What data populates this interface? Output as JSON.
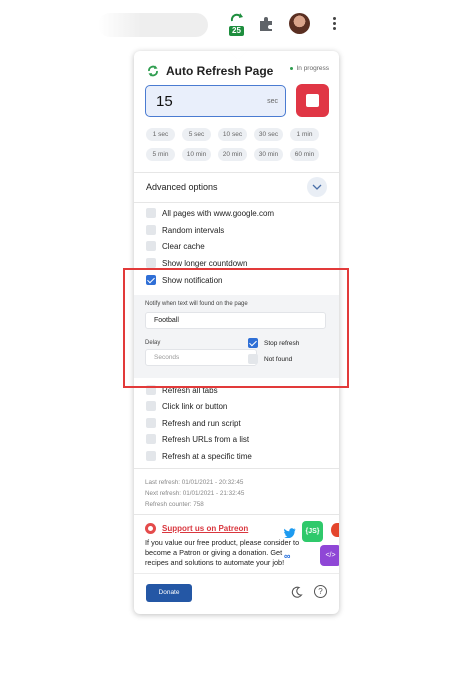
{
  "toolbar": {
    "extension_badge": "25",
    "icons": [
      "refresh-extension-icon",
      "puzzle-icon",
      "avatar",
      "kebab-menu-icon"
    ]
  },
  "popup": {
    "title": "Auto Refresh Page",
    "status": "In progress",
    "timer": {
      "value": "15",
      "unit": "sec"
    },
    "presets": [
      "1 sec",
      "5 sec",
      "10 sec",
      "30 sec",
      "1 min",
      "5 min",
      "10 min",
      "20 min",
      "30 min",
      "60 min"
    ],
    "advanced_title": "Advanced options",
    "options": [
      {
        "label": "All pages with www.google.com",
        "checked": false
      },
      {
        "label": "Random intervals",
        "checked": false
      },
      {
        "label": "Clear cache",
        "checked": false
      },
      {
        "label": "Show longer countdown",
        "checked": false
      },
      {
        "label": "Show notification",
        "checked": true
      }
    ],
    "notification": {
      "label": "Notify when text will found on the page",
      "value": "Football",
      "delay_label": "Delay",
      "delay_placeholder": "Seconds",
      "stop_refresh": {
        "label": "Stop refresh",
        "checked": true
      },
      "not_found": {
        "label": "Not found",
        "checked": false
      }
    },
    "options_more": [
      {
        "label": "Refresh all tabs",
        "checked": false
      },
      {
        "label": "Click link or button",
        "checked": false
      },
      {
        "label": "Refresh and run script",
        "checked": false
      },
      {
        "label": "Refresh URLs from a list",
        "checked": false
      },
      {
        "label": "Refresh at a specific time",
        "checked": false
      }
    ],
    "info": {
      "last_refresh": "Last refresh: 01/01/2021 - 20:32:45",
      "next_refresh": "Next refresh: 01/01/2021 - 21:32:45",
      "counter": "Refresh counter: 758"
    },
    "patreon": {
      "link": "Support us on Patreon",
      "text": "If you value our free product, please consider to become a Patron or giving a donation. Get recipes and solutions to automate your job!"
    },
    "promo": {
      "js_label": "{JS}",
      "code_label": "</>",
      "meta_label": "∞"
    },
    "donate_label": "Donate",
    "help_label": "?"
  },
  "colors": {
    "accent": "#2f6fd6",
    "stop": "#e03645",
    "donate": "#2457a5",
    "annotation": "#e23a3a"
  }
}
